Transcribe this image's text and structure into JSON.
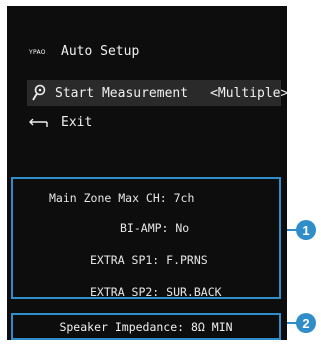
{
  "menu": {
    "auto_setup": {
      "icon_text": "YPAO",
      "label": "Auto Setup"
    },
    "start_measurement": {
      "label": "Start Measurement",
      "value": "<Multiple>",
      "icon": "microphone-icon"
    },
    "exit": {
      "label": "Exit",
      "icon": "return-arrow-icon"
    }
  },
  "info": {
    "lines": [
      "Main Zone Max CH: 7ch",
      "BI-AMP: No",
      "EXTRA SP1: F.PRNS",
      "EXTRA SP2: SUR.BACK"
    ]
  },
  "impedance": {
    "text": "Speaker Impedance: 8Ω MIN"
  },
  "callouts": [
    "1",
    "2"
  ],
  "colors": {
    "screen": "#0d0d0d",
    "highlight": "#2a2a2a",
    "accent": "#2f8ec9"
  }
}
